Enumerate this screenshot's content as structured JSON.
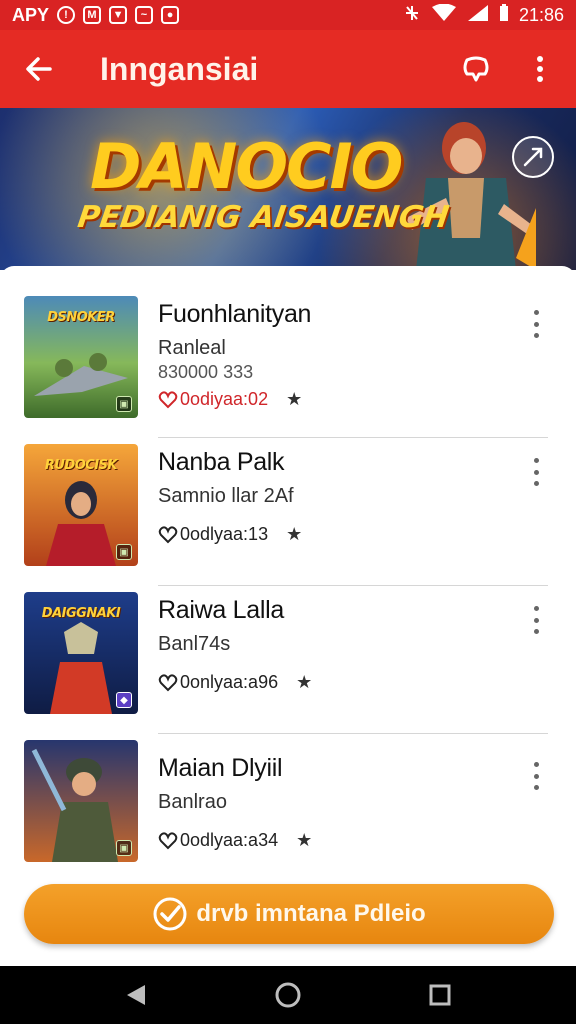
{
  "status_bar": {
    "carrier": "APY",
    "time": "21:86",
    "icons": [
      "notification-icon",
      "gmail-icon",
      "shield-icon",
      "photo-icon",
      "lock-icon",
      "vibrate-icon",
      "wifi-icon",
      "signal-icon",
      "battery-icon"
    ]
  },
  "app_bar": {
    "title": "Inngansiai",
    "icons": [
      "back-arrow-icon",
      "chat-icon",
      "more-vert-icon"
    ]
  },
  "banner": {
    "title": "DANOCIO",
    "subtitle": "PEDIANIG AISAUENGH"
  },
  "games": [
    {
      "thumb_label": "DSNOKER",
      "title": "Fuonhlanityan",
      "subtitle": "Ranleal",
      "plays": "830000 333",
      "meta": "0odiyaa:02",
      "meta_color": "#d0262a",
      "thumb_colors": [
        "#3e6b2a",
        "#86b85a"
      ]
    },
    {
      "thumb_label": "RUDOCISK",
      "title": "Nanba Palk",
      "subtitle": "Samnio llar 2Af",
      "plays": "",
      "meta": "0odlyaa:13",
      "meta_color": "#222222",
      "thumb_colors": [
        "#b2401a",
        "#f5a63a"
      ]
    },
    {
      "thumb_label": "DAIGGNAKI",
      "title": "Raiwa Lalla",
      "subtitle": "Banl74s",
      "plays": "",
      "meta": "0onlyaa:a96",
      "meta_color": "#222222",
      "thumb_colors": [
        "#1e3d8a",
        "#d23a26"
      ]
    },
    {
      "thumb_label": "",
      "title": "Maian Dlyiil",
      "subtitle": "Banlrao",
      "plays": "",
      "meta": "0odlyaa:a34",
      "meta_color": "#222222",
      "thumb_colors": [
        "#27366e",
        "#c9682a"
      ]
    }
  ],
  "cta": {
    "label": "drvb imntana Pdleio",
    "icon": "check-badge-icon",
    "color": "#ef9320"
  },
  "nav_bar": {
    "icons": [
      "back-triangle-icon",
      "home-circle-icon",
      "recents-square-icon"
    ]
  }
}
